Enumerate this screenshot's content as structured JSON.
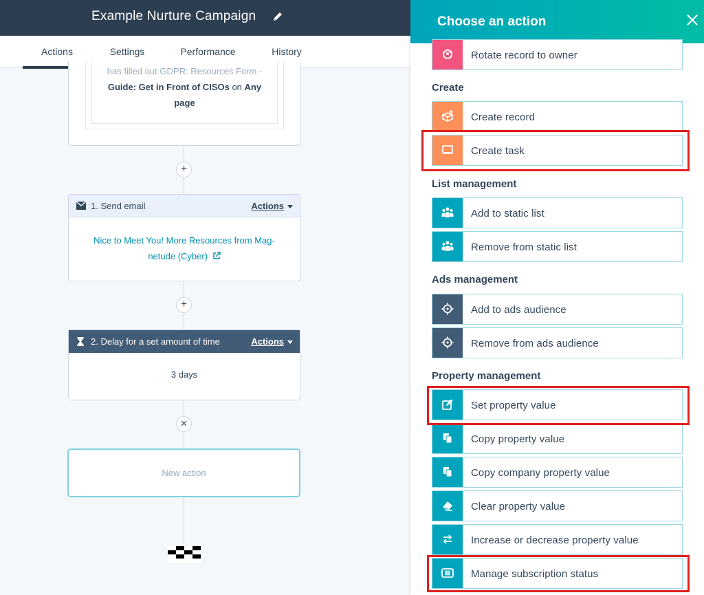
{
  "editor": {
    "title": "Example Nurture Campaign",
    "tabs": [
      {
        "label": "Actions",
        "active": true
      },
      {
        "label": "Settings",
        "active": false
      },
      {
        "label": "Performance",
        "active": false
      },
      {
        "label": "History",
        "active": false
      }
    ],
    "trigger": {
      "line1_muted": "has filled out",
      "line1_form": "GDPR: Resources Form -",
      "line2": "Guide: Get in Front of CISOs",
      "line2_on": "on",
      "line2_any": "Any",
      "line3": "page"
    },
    "email_step": {
      "title": "1. Send email",
      "actions_label": "Actions",
      "link_text": "Nice to Meet You! More Resources from Mag-netude (Cyber)"
    },
    "delay_step": {
      "title": "2. Delay for a set amount of time",
      "actions_label": "Actions",
      "value": "3 days"
    },
    "new_action_label": "New action",
    "plus_glyph": "+",
    "close_glyph": "×"
  },
  "panel": {
    "title": "Choose an action",
    "top_item": {
      "label": "Rotate record to owner",
      "icon": "rotate-owner-icon"
    },
    "sections": [
      {
        "title": "Create",
        "items": [
          {
            "label": "Create record",
            "icon": "create-record-icon"
          },
          {
            "label": "Create task",
            "icon": "create-task-icon",
            "highlighted": true
          }
        ]
      },
      {
        "title": "List management",
        "items": [
          {
            "label": "Add to static list",
            "icon": "people-icon"
          },
          {
            "label": "Remove from static list",
            "icon": "people-icon"
          }
        ]
      },
      {
        "title": "Ads management",
        "items": [
          {
            "label": "Add to ads audience",
            "icon": "crosshair-icon"
          },
          {
            "label": "Remove from ads audience",
            "icon": "crosshair-icon"
          }
        ]
      },
      {
        "title": "Property management",
        "items": [
          {
            "label": "Set property value",
            "icon": "edit-icon",
            "highlighted": true
          },
          {
            "label": "Copy property value",
            "icon": "copy-icon"
          },
          {
            "label": "Copy company property value",
            "icon": "copy-icon"
          },
          {
            "label": "Clear property value",
            "icon": "eraser-icon"
          },
          {
            "label": "Increase or decrease property value",
            "icon": "swap-arrows-icon"
          },
          {
            "label": "Manage subscription status",
            "icon": "subscription-list-icon",
            "highlighted": true
          }
        ]
      }
    ]
  },
  "colors": {
    "header_dark": "#2d3e50",
    "accent_teal": "#00a4bd",
    "accent_green": "#00bda5",
    "pink": "#f2547d",
    "orange": "#ff8f59",
    "slate": "#425b76",
    "highlight_red": "#e02020",
    "link": "#0091ae"
  }
}
